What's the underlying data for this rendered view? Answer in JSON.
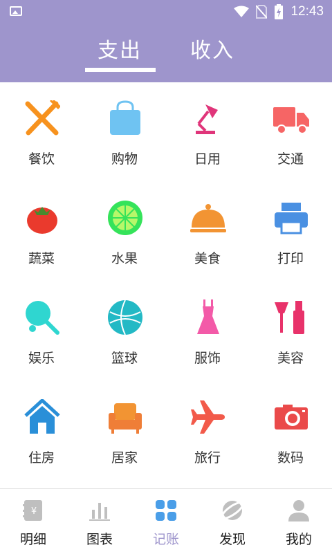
{
  "status_bar": {
    "time": "12:43"
  },
  "tabs": [
    {
      "label": "支出",
      "active": true
    },
    {
      "label": "收入",
      "active": false
    }
  ],
  "categories": [
    {
      "label": "餐饮",
      "icon": "fork-knife-icon",
      "color": "#f7921e"
    },
    {
      "label": "购物",
      "icon": "shopping-bag-icon",
      "color": "#6fc3f2"
    },
    {
      "label": "日用",
      "icon": "desk-lamp-icon",
      "color": "#e0357a"
    },
    {
      "label": "交通",
      "icon": "truck-icon",
      "color": "#f66565"
    },
    {
      "label": "蔬菜",
      "icon": "tomato-icon",
      "color": "#ea3a2d"
    },
    {
      "label": "水果",
      "icon": "lime-icon",
      "color": "#35e35a"
    },
    {
      "label": "美食",
      "icon": "food-cloche-icon",
      "color": "#f29433"
    },
    {
      "label": "打印",
      "icon": "printer-icon",
      "color": "#4a90e2"
    },
    {
      "label": "娱乐",
      "icon": "ping-pong-icon",
      "color": "#2fd6d0"
    },
    {
      "label": "篮球",
      "icon": "basketball-icon",
      "color": "#23b9c5"
    },
    {
      "label": "服饰",
      "icon": "dress-icon",
      "color": "#f35aa8"
    },
    {
      "label": "美容",
      "icon": "cosmetics-icon",
      "color": "#e8326a"
    },
    {
      "label": "住房",
      "icon": "house-icon",
      "color": "#2a8fd8"
    },
    {
      "label": "居家",
      "icon": "sofa-icon",
      "color": "#ef7e37"
    },
    {
      "label": "旅行",
      "icon": "airplane-icon",
      "color": "#f25a4a"
    },
    {
      "label": "数码",
      "icon": "camera-icon",
      "color": "#ea4a4a"
    }
  ],
  "bottom_nav": [
    {
      "label": "明细",
      "icon": "ledger-icon",
      "active": false
    },
    {
      "label": "图表",
      "icon": "bar-chart-icon",
      "active": false
    },
    {
      "label": "记账",
      "icon": "grid-icon",
      "active": true
    },
    {
      "label": "发现",
      "icon": "planet-icon",
      "active": false
    },
    {
      "label": "我的",
      "icon": "user-icon",
      "active": false
    }
  ],
  "colors": {
    "header": "#9e95cc",
    "active_nav": "#9e95cc",
    "inactive_nav_icon": "#bfbfbf"
  }
}
